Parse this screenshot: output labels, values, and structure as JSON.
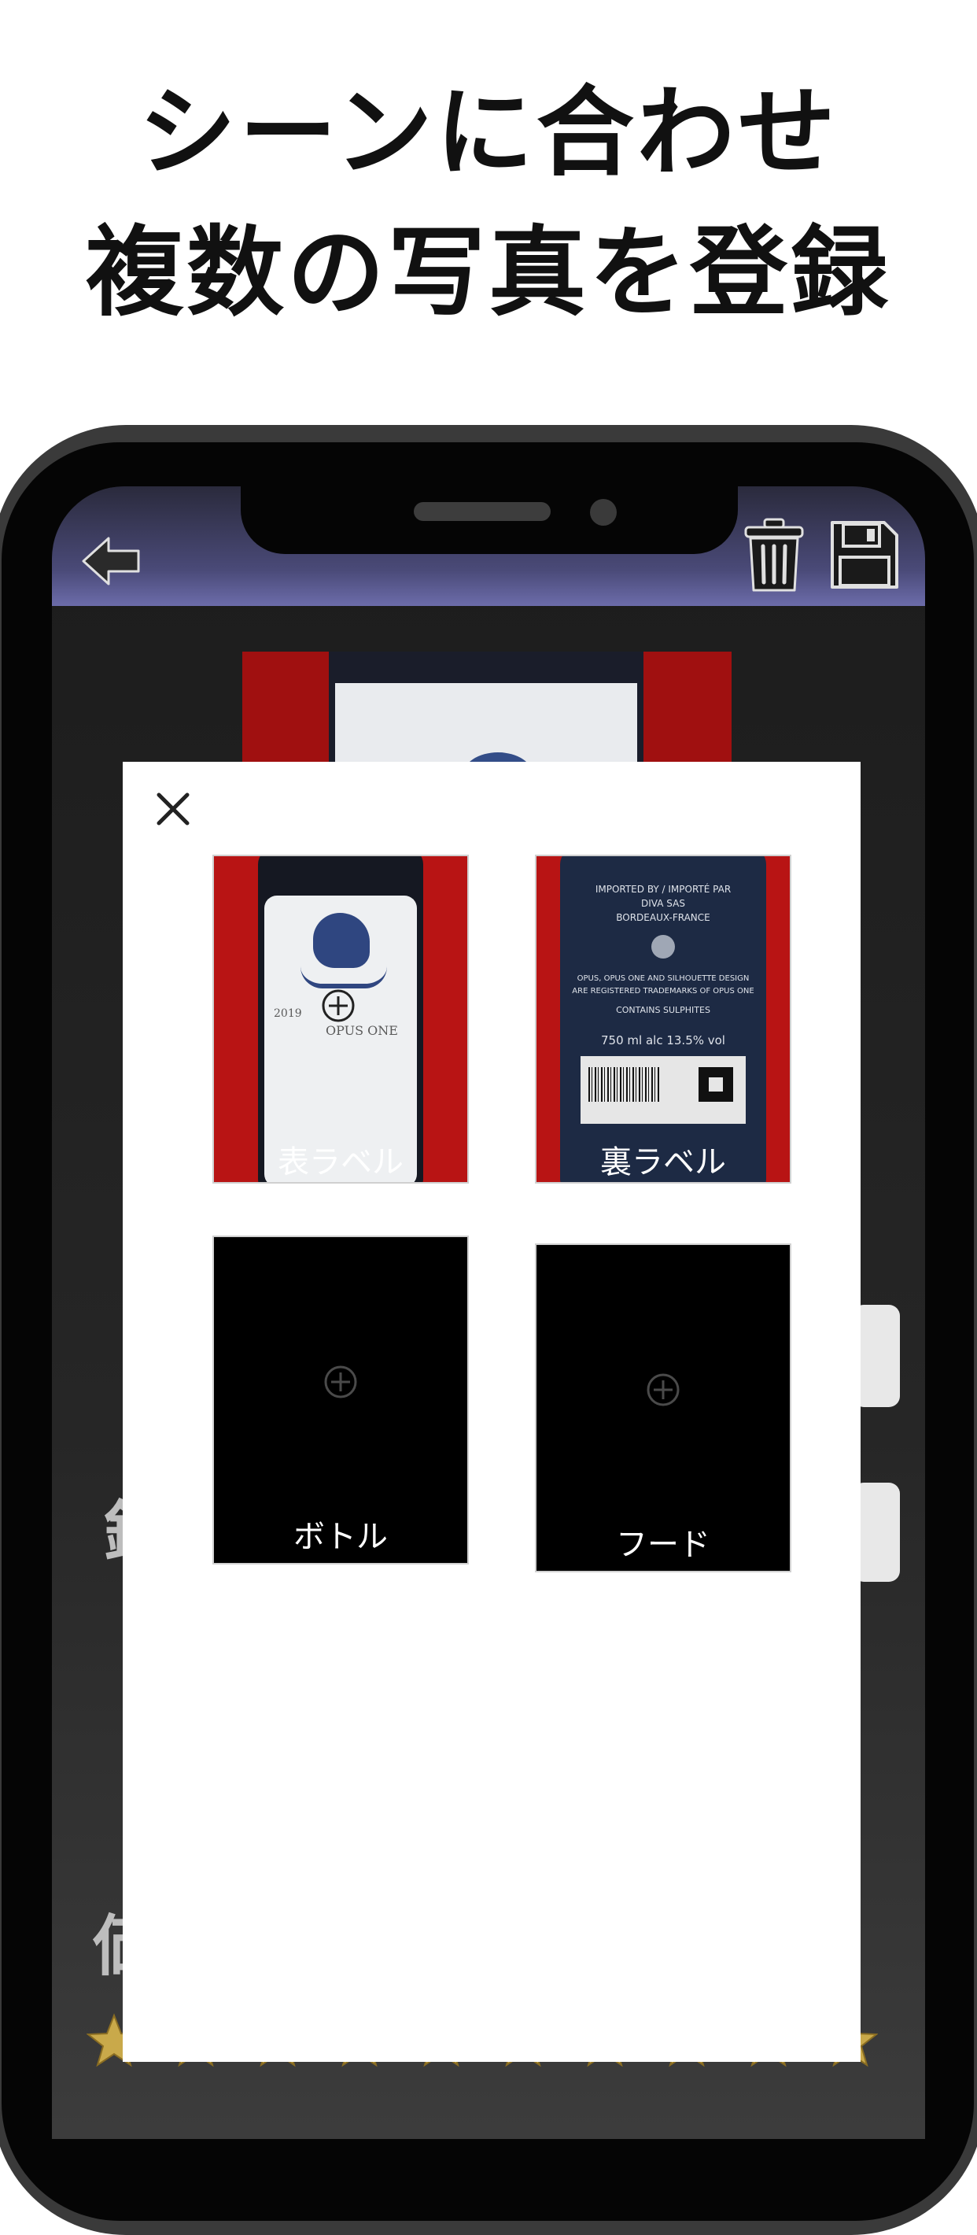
{
  "headline": {
    "line1": "シーンに合わせ",
    "line2": "複数の写真を登録"
  },
  "navbar": {
    "back_icon": "back-arrow-icon",
    "trash_icon": "trash-icon",
    "save_icon": "save-icon"
  },
  "photo_picker": {
    "close_icon": "close-icon",
    "tiles": [
      {
        "label": "表ラベル",
        "has_photo": true,
        "photo_text": {
          "year": "2019",
          "brand": "OPUS ONE"
        }
      },
      {
        "label": "裏ラベル",
        "has_photo": true,
        "photo_text": {
          "l1": "IMPORTED BY / IMPORTÉ PAR",
          "l2": "DIVA SAS",
          "l3": "BORDEAUX-FRANCE",
          "l4": "OPUS, OPUS ONE AND SILHOUETTE DESIGN",
          "l5": "ARE REGISTERED TRADEMARKS OF OPUS ONE",
          "l6": "CONTAINS SULPHITES",
          "l7": "750 ml alc 13.5% vol"
        }
      },
      {
        "label": "ボトル",
        "has_photo": false
      },
      {
        "label": "フード",
        "has_photo": false
      }
    ]
  },
  "background_partial_text": {
    "char1": "銘",
    "char2": "価"
  },
  "rating": {
    "max": 10,
    "value": 10
  }
}
